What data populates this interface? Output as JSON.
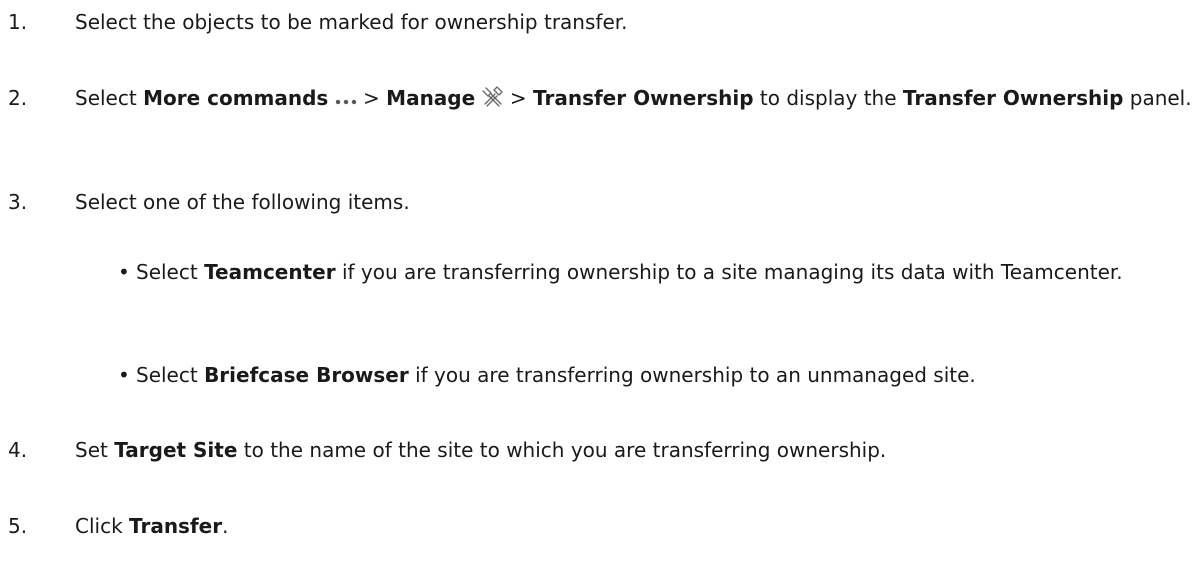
{
  "steps": [
    {
      "num": "1.",
      "t1": "Select the objects to be marked for ownership transfer."
    },
    {
      "num": "2.",
      "t1": "Select ",
      "b1": "More commands",
      "sep1": " > ",
      "b2": "Manage",
      "sep2": " > ",
      "b3": "Transfer Ownership",
      "t2": " to display the ",
      "b4": "Transfer Ownership",
      "t3": " panel."
    },
    {
      "num": "3.",
      "t1": "Select one of the following items."
    },
    {
      "num": "4.",
      "t1": "Set ",
      "b1": "Target Site",
      "t2": " to the name of the site to which you are transferring ownership."
    },
    {
      "num": "5.",
      "t1": "Click ",
      "b1": "Transfer",
      "t2": "."
    }
  ],
  "bullets": [
    {
      "dot": "•",
      "t1": "Select ",
      "b1": "Teamcenter",
      "t2": " if you are transferring ownership to a site managing its data with Teamcenter."
    },
    {
      "dot": "•",
      "t1": "Select ",
      "b1": "Briefcase Browser",
      "t2": " if you are transferring ownership to an unmanaged site."
    }
  ],
  "icons": {
    "more_commands": "more-commands-icon",
    "manage": "manage-icon"
  }
}
